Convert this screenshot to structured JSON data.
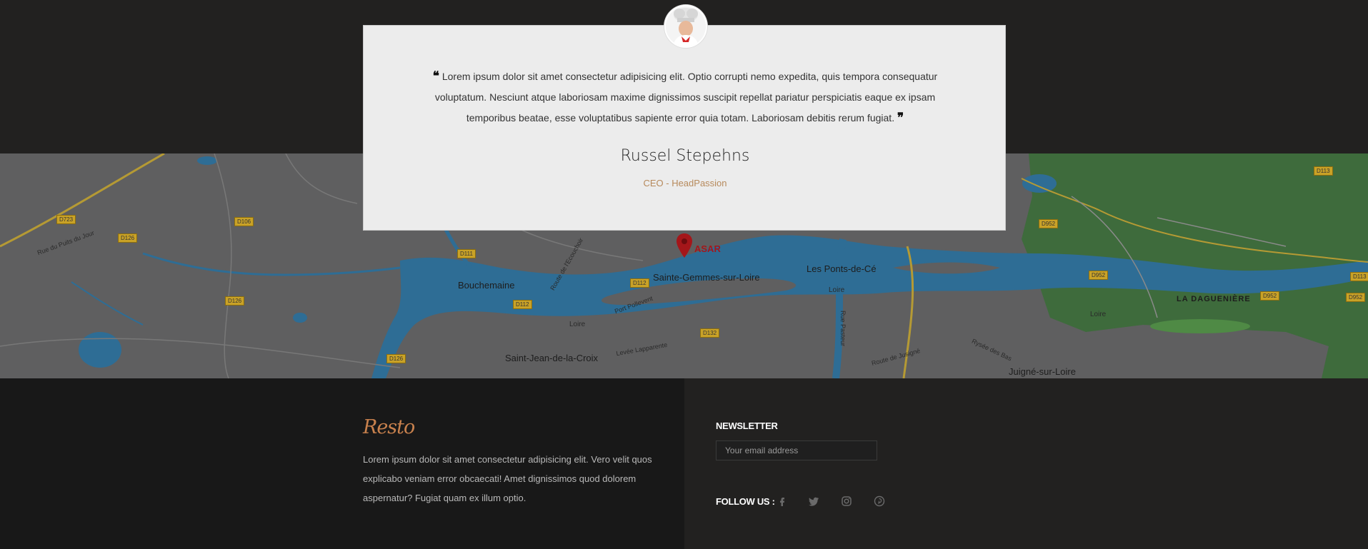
{
  "testimonial": {
    "quote": "Lorem ipsum dolor sit amet consectetur adipisicing elit. Optio corrupti nemo expedita, quis tempora consequatur voluptatum. Nesciunt atque laboriosam maxime dignissimos suscipit repellat pariatur perspiciatis eaque ex ipsam temporibus beatae, esse voluptatibus sapiente error quia totam. Laboriosam debitis rerum fugiat.",
    "open_mark": "❝",
    "close_mark": "❞",
    "name": "Russel Stepehns",
    "role": "CEO - HeadPassion"
  },
  "map": {
    "marker_label": "ASAR",
    "places": [
      "Bouchemaine",
      "Sainte-Gemmes-sur-Loire",
      "Les Ponts-de-Cé",
      "Saint-Jean-de-la-Croix",
      "Juigné-sur-Loire",
      "LA DAGUENIÈRE",
      "Loire",
      "Loire",
      "Loire"
    ],
    "roads": [
      "D723",
      "D126",
      "D106",
      "D111",
      "D112",
      "D112",
      "D132",
      "D126",
      "D126",
      "D952",
      "D952",
      "D952",
      "D113",
      "D113",
      "D952"
    ],
    "streets": [
      "Rue du Puits du Jour",
      "Port Pollevent",
      "Levée Lapparente",
      "Route de Jusigné",
      "Route de l'Ecouchoir",
      "Rue Pasteur",
      "Rysée des Bas"
    ]
  },
  "footer": {
    "brand": "Resto",
    "about": "Lorem ipsum dolor sit amet consectetur adipisicing elit. Vero velit quos explicabo veniam error obcaecati! Amet dignissimos quod dolorem aspernatur? Fugiat quam ex illum optio.",
    "newsletter_title": "NEWSLETTER",
    "email_placeholder": "Your email address",
    "follow_label": "FOLLOW US :",
    "social": [
      "facebook-icon",
      "twitter-icon",
      "instagram-icon",
      "pinterest-icon"
    ]
  },
  "colors": {
    "accent": "#c8814d",
    "dark_bg": "#222120",
    "footer_bg": "#181818",
    "card_bg": "#ececec",
    "map_water": "#2e6d95",
    "map_forest": "#3e6b3c"
  }
}
